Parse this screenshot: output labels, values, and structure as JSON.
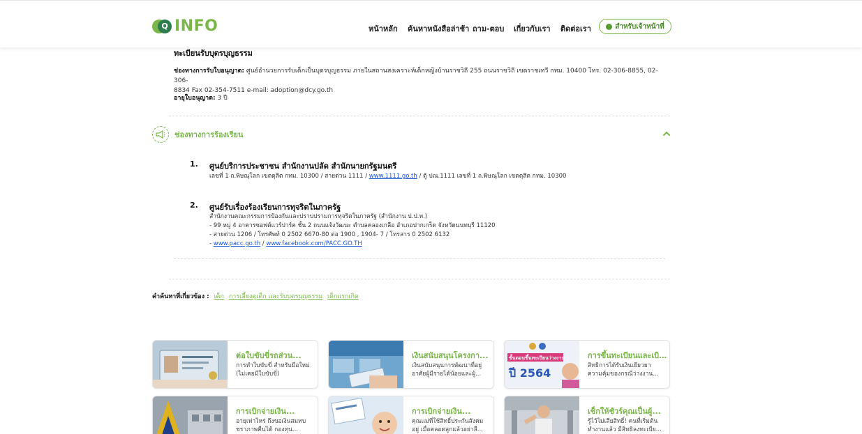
{
  "header": {
    "logo_text": "INFO",
    "nav": [
      "หน้าหลัก",
      "ค้นหาหนังสือล่าช้า",
      "ถาม-ตอบ",
      "เกี่ยวกับเรา",
      "ติดต่อเรา"
    ],
    "staff_button": "สำหรับเจ้าหน้าที่"
  },
  "registration": {
    "title": "ทะเบียนรับบุตรบุญธรรม",
    "channel_label": "ช่องทางการรับใบอนุญาต:",
    "channel_text_1": " ศูนย์อำนวยการรับเด็กเป็นบุตรบุญธรรม ภายในสถานสงเคราะห์เด็กหญิงบ้านราชวิถี 255 ถนนราชวิถี เขตราชเทวี กทม. 10400 โทร. 02-306-8855, 02-306-",
    "channel_text_2": "8834 Fax 02-354-7511 e-mail: adoption@dcy.go.th",
    "validity_label": "อายุใบอนุญาต:",
    "validity_value": " 3 ปี"
  },
  "complaint": {
    "title": "ช่องทางการร้องเรียน",
    "items": [
      {
        "num": "1.",
        "title": "ศูนย์บริการประชาชน สำนักงานปลัด สำนักนายกรัฐมนตรี",
        "line_pre": "เลขที่ 1 ถ.พิษณุโลก เขตดุสิต กทม. 10300 / สายด่วน 1111 / ",
        "link": "www.1111.go.th",
        "line_post": " / ตู้ ปณ.1111 เลขที่ 1 ถ.พิษณุโลก เขตดุสิต กทม. 10300"
      },
      {
        "num": "2.",
        "title": "ศูนย์รับเรื่องร้องเรียนการทุจริตในภาครัฐ",
        "lines": [
          "สำนักงานคณะกรรมการป้องกันและปราบปรามการทุจริตในภาครัฐ (สำนักงาน ป.ป.ท.)",
          "- 99 หมู่ 4 อาคารซอฟต์แวร์ปาร์ค ชั้น 2 ถนนแจ้งวัฒนะ ตำบลคลองเกลือ อำเภอปากเกร็ด จังหวัดนนทบุรี 11120",
          "- สายด่วน 1206 / โทรศัพท์ 0 2502 6670-80 ต่อ 1900 , 1904- 7 / โทรสาร 0 2502 6132"
        ],
        "link_prefix": "- ",
        "link1": "www.pacc.go.th",
        "sep": " / ",
        "link2": "www.facebook.com/PACC.GO.TH"
      }
    ]
  },
  "related": {
    "label": "คำค้นหาที่เกี่ยวข้อง :",
    "tags": [
      "เด็ก",
      "การเลี้ยงดูเด็ก และรับบุตรบุญธรรม",
      "เด็กแรกเกิด"
    ]
  },
  "cards": [
    {
      "title": "ต่อใบขับขี่รถส่วน...",
      "desc1": "การทำใบขับขี่ สำหรับมือใหม่",
      "desc2": "(ไม่เคยมีใบขับขี่)"
    },
    {
      "title": "เงินสนับสนุนโครงกา...",
      "desc1": "เงินสนับสนุนการพัฒนาที่อยู่",
      "desc2": "อาศัยผู้มีรายได้น้อยและผู้..."
    },
    {
      "title": "การขึ้นทะเบียนและเบิ...",
      "desc1": "สิทธิการได้รับเงินเยียวยา",
      "desc2": "ความคุ้มของกรณีว่างงาน..."
    },
    {
      "title": "การเบิกจ่ายเงิน...",
      "desc1": "อายุเท่าไหร่ ถึงขอเงินสมทบ",
      "desc2": "ชราภาพคืนได้ กองทุน..."
    },
    {
      "title": "การเบิกจ่ายเงิน...",
      "desc1": "คุณแม่ที่ใช้สิทธิ์ประกันสังคม",
      "desc2": "อยู่ เมื่อคลอดลูกแล้วอย่าลื..."
    },
    {
      "title": "เช็กให้ชัวร์คุณเป็นผู้...",
      "desc1": "รู้ไว้ไม่เสียสิทธิ์! คนที่เริ่มต้น",
      "desc2": "ทำงานแล้ว มีสิทธิลงทะเบีย..."
    }
  ],
  "thumb_texts": {
    "card3_big": "ปี 2564",
    "card3_banner": "ขั้นตอนขึ้นทะเบียนว่างงาน"
  },
  "colors": {
    "brand_green": "#7ab648",
    "link_blue": "#1a56d6"
  }
}
